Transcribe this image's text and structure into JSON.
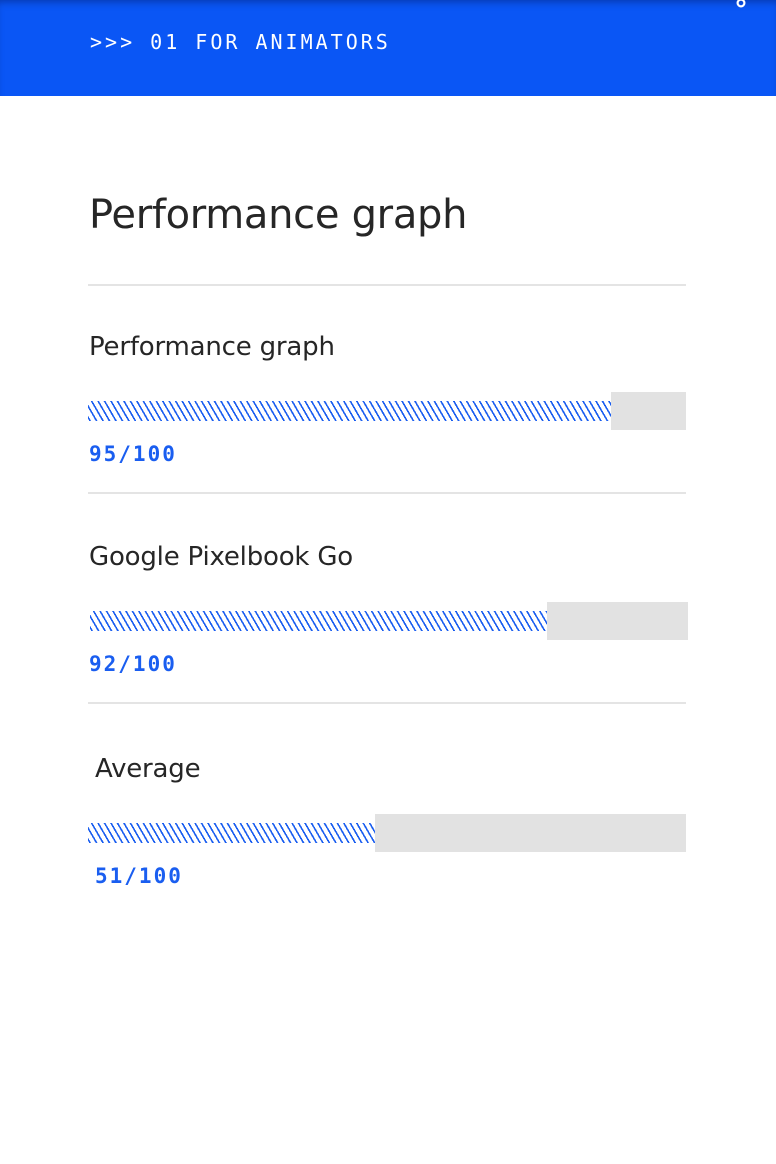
{
  "header": {
    "label": ">>> 01 FOR ANIMATORS",
    "background_color": "#0a56f5",
    "corner_icon": "link-icon"
  },
  "page": {
    "title": "Performance graph"
  },
  "accent_color": "#1a5ef0",
  "metrics": [
    {
      "label": "Performance graph",
      "score_text": "95/100",
      "score": 95,
      "max": 100
    },
    {
      "label": "Google Pixelbook Go",
      "score_text": "92/100",
      "score": 92,
      "max": 100
    },
    {
      "label": "Average",
      "score_text": "51/100",
      "score": 51,
      "max": 100
    }
  ]
}
